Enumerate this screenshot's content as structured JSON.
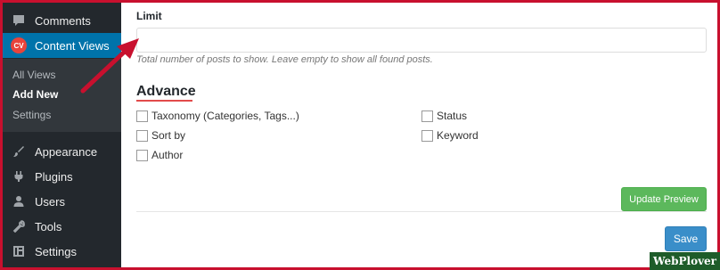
{
  "sidebar": {
    "items_top": [
      {
        "label": "Comments",
        "icon": "comment-icon"
      },
      {
        "label": "Content Views",
        "icon": "cv-badge",
        "badge": "CV",
        "active": true
      }
    ],
    "submenu": [
      {
        "label": "All Views"
      },
      {
        "label": "Add New",
        "current": true
      },
      {
        "label": "Settings"
      }
    ],
    "items_bottom": [
      {
        "label": "Appearance",
        "icon": "paintbrush-icon"
      },
      {
        "label": "Plugins",
        "icon": "plug-icon"
      },
      {
        "label": "Users",
        "icon": "user-icon"
      },
      {
        "label": "Tools",
        "icon": "wrench-icon"
      },
      {
        "label": "Settings",
        "icon": "settings-icon"
      }
    ],
    "active_color": "#0073aa",
    "bg_color": "#23282d"
  },
  "form": {
    "limit_label": "Limit",
    "limit_value": "",
    "limit_help": "Total number of posts to show. Leave empty to show all found posts.",
    "advance_title": "Advance",
    "checkboxes": [
      {
        "label": "Taxonomy (Categories, Tags...)",
        "checked": false
      },
      {
        "label": "Status",
        "checked": false
      },
      {
        "label": "Sort by",
        "checked": false
      },
      {
        "label": "Keyword",
        "checked": false
      },
      {
        "label": "Author",
        "checked": false
      }
    ],
    "update_preview_label": "Update Preview",
    "save_label": "Save"
  },
  "watermark": "WebPlover",
  "colors": {
    "preview_button": "#5cb85c",
    "save_button": "#3a8ec9",
    "frame": "#c8102e",
    "arrow": "#c8102e",
    "underline": "#e24b4b"
  }
}
